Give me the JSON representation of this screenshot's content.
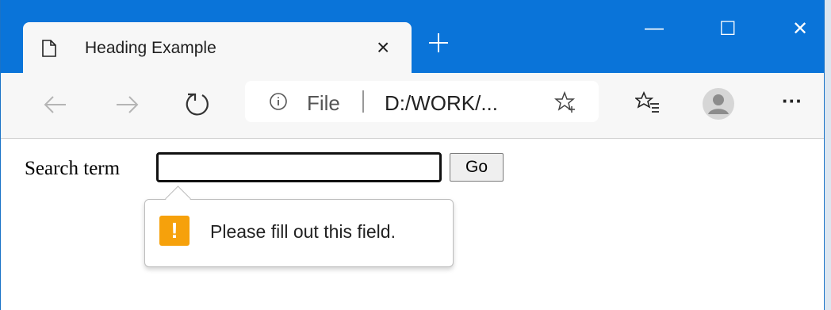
{
  "browser": {
    "tab": {
      "title": "Heading Example",
      "close_glyph": "×",
      "icon": "page-icon"
    },
    "new_tab_icon": "plus-icon",
    "window_controls": {
      "minimize": "—",
      "maximize": "☐",
      "close": "✕"
    },
    "toolbar": {
      "back_icon": "arrow-left-icon",
      "forward_icon": "arrow-right-icon",
      "refresh_icon": "refresh-icon",
      "address": {
        "scheme": "File",
        "url": "D:/WORK/...",
        "info_icon": "info-icon",
        "favorite_icon": "star-add-icon"
      },
      "favorites_icon": "favorites-list-icon",
      "profile_icon": "profile-avatar-icon",
      "menu_label": "···"
    },
    "accent_color": "#0a74d9"
  },
  "page": {
    "form": {
      "label": "Search term",
      "input_value": "",
      "button_label": "Go"
    },
    "validation": {
      "message": "Please fill out this field.",
      "icon_glyph": "!",
      "icon_color": "#f6a10b"
    }
  }
}
